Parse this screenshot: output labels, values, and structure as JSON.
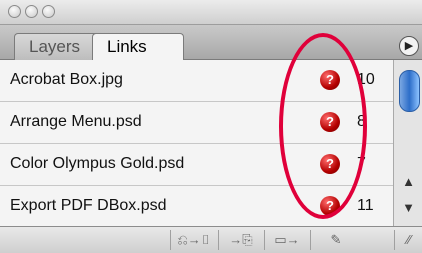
{
  "window": {
    "controls": [
      "close",
      "minimize",
      "zoom"
    ]
  },
  "tabs": [
    {
      "label": "Layers",
      "active": false
    },
    {
      "label": "Links",
      "active": true
    }
  ],
  "links": [
    {
      "name": "Acrobat Box.jpg",
      "status_icon": "missing-link-icon",
      "status_glyph": "?",
      "page": "10"
    },
    {
      "name": "Arrange Menu.psd",
      "status_icon": "missing-link-icon",
      "status_glyph": "?",
      "page": "8"
    },
    {
      "name": "Color Olympus Gold.psd",
      "status_icon": "missing-link-icon",
      "status_glyph": "?",
      "page": "7"
    },
    {
      "name": "Export PDF DBox.psd",
      "status_icon": "missing-link-icon",
      "status_glyph": "?",
      "page": "11"
    }
  ],
  "bottom_toolbar": [
    {
      "icon": "relink-icon",
      "glyph": "⎌→▯"
    },
    {
      "icon": "go-to-link-icon",
      "glyph": "→⎘"
    },
    {
      "icon": "update-link-icon",
      "glyph": "▭→"
    },
    {
      "icon": "edit-original-icon",
      "glyph": "✎"
    }
  ],
  "annotation": {
    "color": "#e0003a"
  },
  "colors": {
    "missing_badge": "#b40000",
    "scroll_thumb": "#2d6ec9"
  }
}
